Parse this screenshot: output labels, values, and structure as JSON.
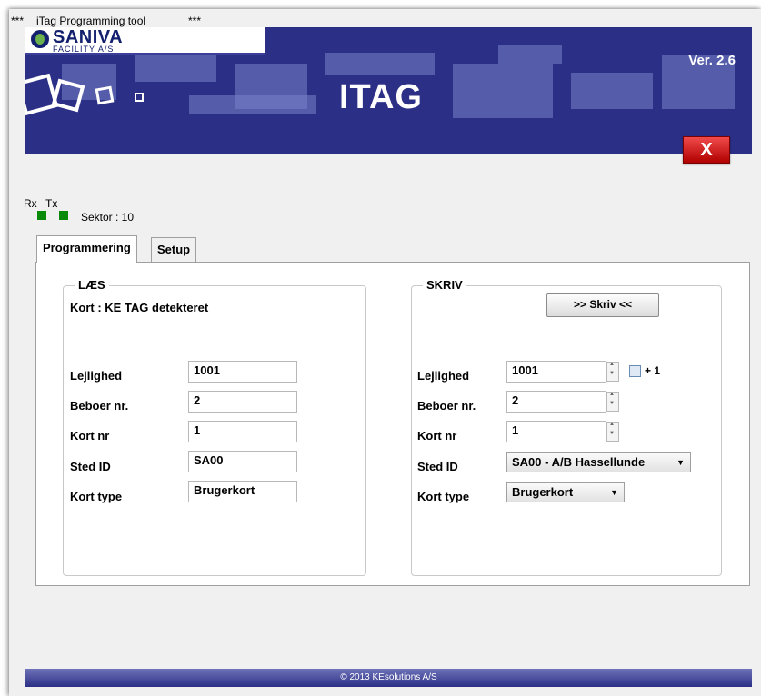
{
  "window": {
    "title_prefix": "***",
    "title": "iTag Programming tool",
    "title_suffix": "***"
  },
  "banner": {
    "brand": "SANIVA",
    "brand_sub": "FACILITY A/S",
    "app_name": "ITAG",
    "version": "Ver. 2.6",
    "close_label": "X"
  },
  "status": {
    "rx_label": "Rx",
    "tx_label": "Tx",
    "sektor": "Sektor : 10",
    "led_color": "#0a8a0a"
  },
  "tabs": [
    {
      "label": "Programmering",
      "active": true
    },
    {
      "label": "Setup",
      "active": false
    }
  ],
  "read": {
    "legend": "LÆS",
    "status": "Kort : KE TAG detekteret",
    "labels": {
      "lejlighed": "Lejlighed",
      "beboer": "Beboer nr.",
      "kort_nr": "Kort nr",
      "sted_id": "Sted ID",
      "kort_type": "Kort type"
    },
    "values": {
      "lejlighed": "1001",
      "beboer": "2",
      "kort_nr": "1",
      "sted_id": "SA00",
      "kort_type": "Brugerkort"
    }
  },
  "write": {
    "legend": "SKRIV",
    "button": ">> Skriv <<",
    "plus_one": "+ 1",
    "labels": {
      "lejlighed": "Lejlighed",
      "beboer": "Beboer nr.",
      "kort_nr": "Kort nr",
      "sted_id": "Sted ID",
      "kort_type": "Kort type"
    },
    "values": {
      "lejlighed": "1001",
      "beboer": "2",
      "kort_nr": "1",
      "sted_id": "SA00 - A/B Hassellunde",
      "kort_type": "Brugerkort"
    }
  },
  "footer": "© 2013 KEsolutions A/S",
  "colors": {
    "banner": "#2b2f86",
    "close": "#d11a1a"
  }
}
